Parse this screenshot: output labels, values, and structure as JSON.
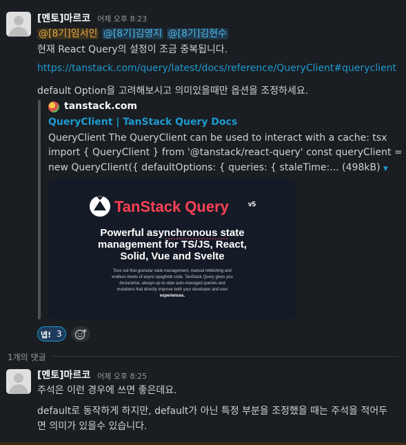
{
  "message1": {
    "author": "[멘토]마르코",
    "time": "어제 오후 8:23",
    "mentions": [
      "@[8기]임서인",
      "@[8기]김영지",
      "@[8기]김현수"
    ],
    "text1": "현재 React Query의 설정이 조금 중복됩니다.",
    "link": "https://tanstack.com/query/latest/docs/reference/QueryClient#queryclient",
    "text2": "default Option을 고려해보시고 의미있을때만 옵션을 조정하세요."
  },
  "unfurl": {
    "site": "tanstack.com",
    "title": "QueryClient | TanStack Query Docs",
    "desc_line1": "QueryClient The QueryClient can be used to interact with a cache: tsx",
    "desc_line2": "import { QueryClient } from '@tanstack/react-query' const queryClient =",
    "desc_line3": "new QueryClient({ defaultOptions: { queries: { staleTime:... (498kB)",
    "preview": {
      "brand": "TanStack Query",
      "version": "v5",
      "headline1": "Powerful asynchronous state",
      "headline2": "management for TS/JS, React,",
      "headline3": "Solid, Vue and Svelte",
      "body1": "Toss out that granular state management, manual refetching and",
      "body2": "endless bowls of async-spaghetti code. TanStack Query gives you",
      "body3": "declarative, always-up-to-date auto-managed queries and",
      "body4": "mutations that directly improve both your developer and user",
      "body5": "experiences."
    }
  },
  "reactions": {
    "first_emoji": "넵!",
    "first_count": "3",
    "add_icon": "add-reaction-icon"
  },
  "thread": {
    "reply_count": "1개의 댓글"
  },
  "message2": {
    "author": "[멘토]마르코",
    "time": "어제 오후 8:25",
    "text1": "주석은 이런 경우에 쓰면 좋은데요.",
    "text2": "default로 동작하게 하지만, default가 아닌 특정 부분을 조정했을 때는 주석을 적어두",
    "text3": "면 의미가 있을수 있습니다."
  },
  "colors": {
    "background": "#1a1d21",
    "link": "#1d9bd1",
    "mention_highlight": "#e8a83e",
    "preview_brand": "#ff4154"
  }
}
